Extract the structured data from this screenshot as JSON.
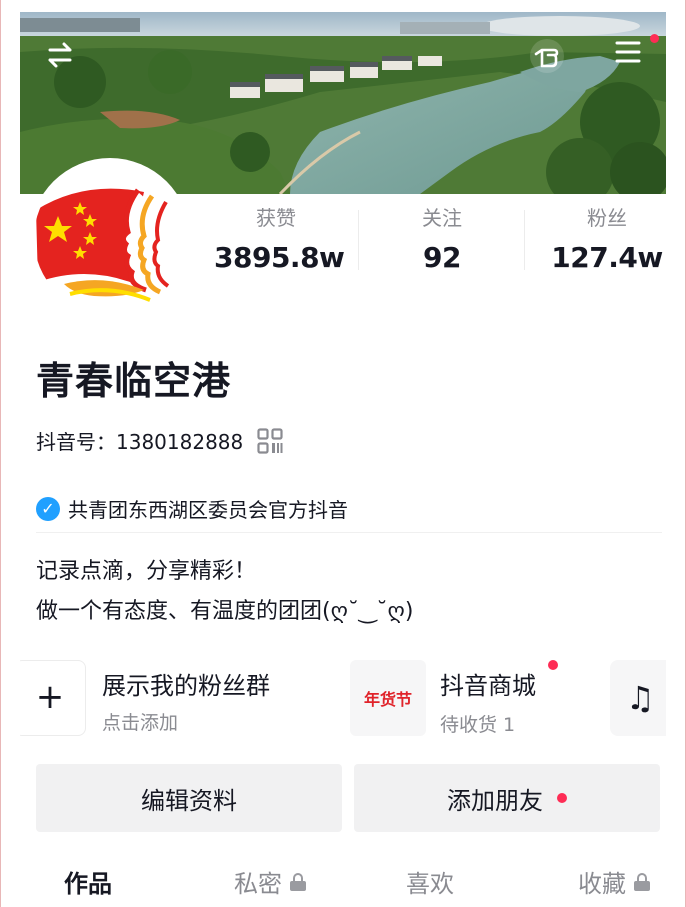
{
  "header": {
    "icons": [
      "switch-account-icon",
      "pointing-hand-icon",
      "menu-icon"
    ],
    "has_notification": true
  },
  "stats": {
    "likes_label": "获赞",
    "likes_value": "3895.8w",
    "following_label": "关注",
    "following_value": "92",
    "followers_label": "粉丝",
    "followers_value": "127.4w"
  },
  "profile": {
    "name": "青春临空港",
    "douyin_id": "抖音号：1380182888",
    "verification": "共青团东西湖区委员会官方抖音",
    "bio_line1": "记录点滴，分享精彩！",
    "bio_line2": "做一个有态度、有温度的团团(ღ˘‿˘ღ)"
  },
  "services": {
    "fan_group_title": "展示我的粉丝群",
    "fan_group_sub": "点击添加",
    "shop_badge": "年货节",
    "shop_title": "抖音商城",
    "shop_sub": "待收货 1"
  },
  "buttons": {
    "edit_profile": "编辑资料",
    "add_friend": "添加朋友"
  },
  "tabs": {
    "works": "作品",
    "private": "私密",
    "likes": "喜欢",
    "favorites": "收藏"
  },
  "colors": {
    "accent_red": "#fe2c55",
    "verify_blue": "#20a0ff",
    "muted_text": "#8a8b91"
  }
}
